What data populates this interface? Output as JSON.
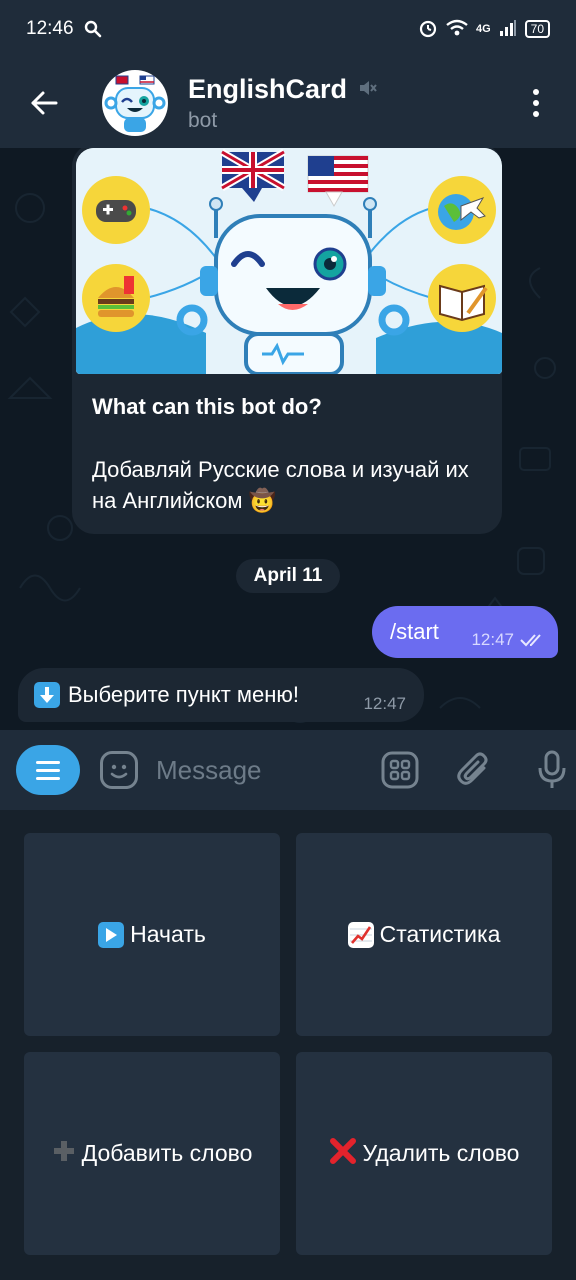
{
  "status_bar": {
    "time": "12:46",
    "network": "4G",
    "battery": "70"
  },
  "header": {
    "title": "EnglishCard",
    "subtitle": "bot",
    "avatar_icon": "robot-avatar",
    "mute_icon": "muted-speaker-icon"
  },
  "messages": {
    "bot_card": {
      "heading": "What can this bot do?",
      "description": "Добавляй Русские слова и изучай их на Английском",
      "description_emoji": "🤠"
    },
    "date_separator": "April 11",
    "outgoing": {
      "text": "/start",
      "time": "12:47"
    },
    "incoming": {
      "emoji": "⬇️",
      "text": "Выберите пункт меню!",
      "time": "12:47"
    }
  },
  "input": {
    "placeholder": "Message"
  },
  "keyboard": {
    "buttons": [
      {
        "emoji": "▶️",
        "label": "Начать"
      },
      {
        "emoji": "📈",
        "label": "Статистика"
      },
      {
        "emoji": "➕",
        "label": "Добавить слово"
      },
      {
        "emoji": "❌",
        "label": "Удалить слово"
      }
    ]
  },
  "colors": {
    "header_bg": "#1f2c3a",
    "chat_bg": "#0f1923",
    "outgoing_bubble": "#6b6cf0",
    "incoming_bubble": "#1c2733",
    "accent": "#3aa5e6",
    "keyboard_button": "#243140"
  }
}
